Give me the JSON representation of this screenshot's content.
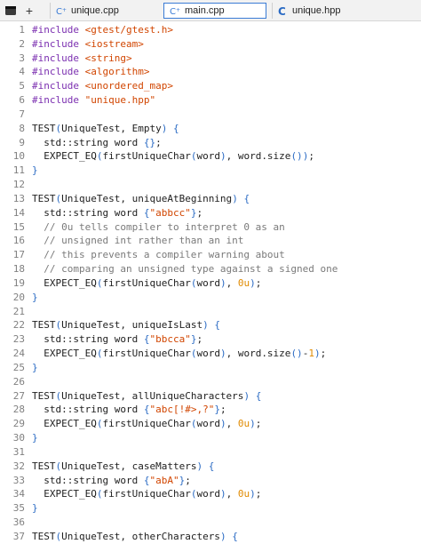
{
  "toolbar": {
    "menu_icon": "menu-icon",
    "add_icon": "plus-icon",
    "add_label": "+"
  },
  "tabs": [
    {
      "label": "unique.cpp",
      "icon": "cpp-file-icon",
      "active": false
    },
    {
      "label": "main.cpp",
      "icon": "cpp-file-icon",
      "active": true
    },
    {
      "label": "unique.hpp",
      "icon": "c-file-icon",
      "active": false
    }
  ],
  "colors": {
    "preprocessor": "#7b2fb0",
    "string": "#d14500",
    "punctuation": "#2b6bc4",
    "number": "#e08a00",
    "comment": "#7a7a7a",
    "line_number": "#808080",
    "active_tab_border": "#3a7bd5"
  },
  "lines": [
    {
      "n": "1",
      "seg": [
        [
          "pp",
          "#include "
        ],
        [
          "str",
          "<gtest/gtest.h>"
        ]
      ]
    },
    {
      "n": "2",
      "seg": [
        [
          "pp",
          "#include "
        ],
        [
          "str",
          "<iostream>"
        ]
      ]
    },
    {
      "n": "3",
      "seg": [
        [
          "pp",
          "#include "
        ],
        [
          "str",
          "<string>"
        ]
      ]
    },
    {
      "n": "4",
      "seg": [
        [
          "pp",
          "#include "
        ],
        [
          "str",
          "<algorithm>"
        ]
      ]
    },
    {
      "n": "5",
      "seg": [
        [
          "pp",
          "#include "
        ],
        [
          "str",
          "<unordered_map>"
        ]
      ]
    },
    {
      "n": "6",
      "seg": [
        [
          "pp",
          "#include "
        ],
        [
          "str",
          "\"unique.hpp\""
        ]
      ]
    },
    {
      "n": "7",
      "seg": []
    },
    {
      "n": "8",
      "seg": [
        [
          "",
          "TEST"
        ],
        [
          "pun",
          "("
        ],
        [
          "",
          "UniqueTest, Empty"
        ],
        [
          "pun",
          ")"
        ],
        [
          "",
          " "
        ],
        [
          "pun",
          "{"
        ]
      ]
    },
    {
      "n": "9",
      "seg": [
        [
          "",
          "  std::string word "
        ],
        [
          "pun",
          "{}"
        ],
        [
          "",
          ";"
        ]
      ]
    },
    {
      "n": "10",
      "seg": [
        [
          "",
          "  EXPECT_EQ"
        ],
        [
          "pun",
          "("
        ],
        [
          "",
          "firstUniqueChar"
        ],
        [
          "pun",
          "("
        ],
        [
          "",
          "word"
        ],
        [
          "pun",
          ")"
        ],
        [
          "",
          ", word.size"
        ],
        [
          "pun",
          "()"
        ],
        [
          "pun",
          ")"
        ],
        [
          "",
          ";"
        ]
      ]
    },
    {
      "n": "11",
      "seg": [
        [
          "pun",
          "}"
        ]
      ]
    },
    {
      "n": "12",
      "seg": []
    },
    {
      "n": "13",
      "seg": [
        [
          "",
          "TEST"
        ],
        [
          "pun",
          "("
        ],
        [
          "",
          "UniqueTest, uniqueAtBeginning"
        ],
        [
          "pun",
          ")"
        ],
        [
          "",
          " "
        ],
        [
          "pun",
          "{"
        ]
      ]
    },
    {
      "n": "14",
      "seg": [
        [
          "",
          "  std::string word "
        ],
        [
          "pun",
          "{"
        ],
        [
          "str",
          "\"abbcc\""
        ],
        [
          "pun",
          "}"
        ],
        [
          "",
          ";"
        ]
      ]
    },
    {
      "n": "15",
      "seg": [
        [
          "cmt",
          "  // 0u tells compiler to interpret 0 as an"
        ]
      ]
    },
    {
      "n": "16",
      "seg": [
        [
          "cmt",
          "  // unsigned int rather than an int"
        ]
      ]
    },
    {
      "n": "17",
      "seg": [
        [
          "cmt",
          "  // this prevents a compiler warning about"
        ]
      ]
    },
    {
      "n": "18",
      "seg": [
        [
          "cmt",
          "  // comparing an unsigned type against a signed one"
        ]
      ]
    },
    {
      "n": "19",
      "seg": [
        [
          "",
          "  EXPECT_EQ"
        ],
        [
          "pun",
          "("
        ],
        [
          "",
          "firstUniqueChar"
        ],
        [
          "pun",
          "("
        ],
        [
          "",
          "word"
        ],
        [
          "pun",
          ")"
        ],
        [
          "",
          ", "
        ],
        [
          "num",
          "0u"
        ],
        [
          "pun",
          ")"
        ],
        [
          "",
          ";"
        ]
      ]
    },
    {
      "n": "20",
      "seg": [
        [
          "pun",
          "}"
        ]
      ]
    },
    {
      "n": "21",
      "seg": []
    },
    {
      "n": "22",
      "seg": [
        [
          "",
          "TEST"
        ],
        [
          "pun",
          "("
        ],
        [
          "",
          "UniqueTest, uniqueIsLast"
        ],
        [
          "pun",
          ")"
        ],
        [
          "",
          " "
        ],
        [
          "pun",
          "{"
        ]
      ]
    },
    {
      "n": "23",
      "seg": [
        [
          "",
          "  std::string word "
        ],
        [
          "pun",
          "{"
        ],
        [
          "str",
          "\"bbcca\""
        ],
        [
          "pun",
          "}"
        ],
        [
          "",
          ";"
        ]
      ]
    },
    {
      "n": "24",
      "seg": [
        [
          "",
          "  EXPECT_EQ"
        ],
        [
          "pun",
          "("
        ],
        [
          "",
          "firstUniqueChar"
        ],
        [
          "pun",
          "("
        ],
        [
          "",
          "word"
        ],
        [
          "pun",
          ")"
        ],
        [
          "",
          ", word.size"
        ],
        [
          "pun",
          "()"
        ],
        [
          "",
          "-"
        ],
        [
          "num",
          "1"
        ],
        [
          "pun",
          ")"
        ],
        [
          "",
          ";"
        ]
      ]
    },
    {
      "n": "25",
      "seg": [
        [
          "pun",
          "}"
        ]
      ]
    },
    {
      "n": "26",
      "seg": []
    },
    {
      "n": "27",
      "seg": [
        [
          "",
          "TEST"
        ],
        [
          "pun",
          "("
        ],
        [
          "",
          "UniqueTest, allUniqueCharacters"
        ],
        [
          "pun",
          ")"
        ],
        [
          "",
          " "
        ],
        [
          "pun",
          "{"
        ]
      ]
    },
    {
      "n": "28",
      "seg": [
        [
          "",
          "  std::string word "
        ],
        [
          "pun",
          "{"
        ],
        [
          "str",
          "\"abc[!#>,?\""
        ],
        [
          "pun",
          "}"
        ],
        [
          "",
          ";"
        ]
      ]
    },
    {
      "n": "29",
      "seg": [
        [
          "",
          "  EXPECT_EQ"
        ],
        [
          "pun",
          "("
        ],
        [
          "",
          "firstUniqueChar"
        ],
        [
          "pun",
          "("
        ],
        [
          "",
          "word"
        ],
        [
          "pun",
          ")"
        ],
        [
          "",
          ", "
        ],
        [
          "num",
          "0u"
        ],
        [
          "pun",
          ")"
        ],
        [
          "",
          ";"
        ]
      ]
    },
    {
      "n": "30",
      "seg": [
        [
          "pun",
          "}"
        ]
      ]
    },
    {
      "n": "31",
      "seg": []
    },
    {
      "n": "32",
      "seg": [
        [
          "",
          "TEST"
        ],
        [
          "pun",
          "("
        ],
        [
          "",
          "UniqueTest, caseMatters"
        ],
        [
          "pun",
          ")"
        ],
        [
          "",
          " "
        ],
        [
          "pun",
          "{"
        ]
      ]
    },
    {
      "n": "33",
      "seg": [
        [
          "",
          "  std::string word "
        ],
        [
          "pun",
          "{"
        ],
        [
          "str",
          "\"abA\""
        ],
        [
          "pun",
          "}"
        ],
        [
          "",
          ";"
        ]
      ]
    },
    {
      "n": "34",
      "seg": [
        [
          "",
          "  EXPECT_EQ"
        ],
        [
          "pun",
          "("
        ],
        [
          "",
          "firstUniqueChar"
        ],
        [
          "pun",
          "("
        ],
        [
          "",
          "word"
        ],
        [
          "pun",
          ")"
        ],
        [
          "",
          ", "
        ],
        [
          "num",
          "0u"
        ],
        [
          "pun",
          ")"
        ],
        [
          "",
          ";"
        ]
      ]
    },
    {
      "n": "35",
      "seg": [
        [
          "pun",
          "}"
        ]
      ]
    },
    {
      "n": "36",
      "seg": []
    },
    {
      "n": "37",
      "seg": [
        [
          "",
          "TEST"
        ],
        [
          "pun",
          "("
        ],
        [
          "",
          "UniqueTest, otherCharacters"
        ],
        [
          "pun",
          ")"
        ],
        [
          "",
          " "
        ],
        [
          "pun",
          "{"
        ]
      ]
    }
  ]
}
